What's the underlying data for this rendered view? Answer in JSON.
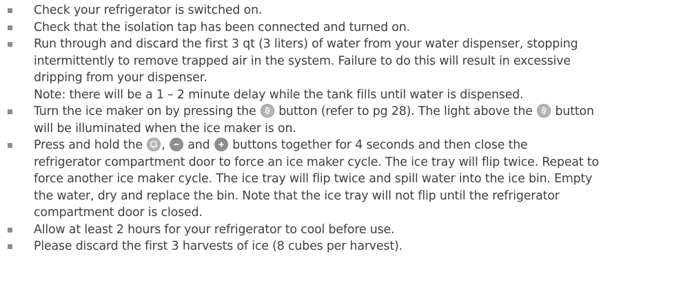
{
  "items": [
    {
      "lines": [
        "Check your refrigerator is switched on."
      ]
    },
    {
      "lines": [
        "Check that the isolation tap has been connected and turned on."
      ]
    },
    {
      "lines": [
        "Run through and discard the first 3 qt (3 liters) of water from your water dispenser, stopping",
        "intermittently to remove trapped air in the system. Failure to do this will result in excessive",
        "dripping from your dispenser.",
        "Note: there will be a 1 – 2 minute delay while the tank fills until water is dispensed."
      ]
    },
    {
      "icemaker": {
        "l1_a": "Turn the ice maker on by pressing the ",
        "l1_b": " button (refer to pg 28). The light above the ",
        "l1_c": " button",
        "l2": "will be illuminated when the ice maker is on."
      }
    },
    {
      "force": {
        "l1_a": "Press and hold the ",
        "l1_b": ", ",
        "l1_c": " and ",
        "l1_d": " buttons together for 4 seconds and then close the",
        "rest": [
          "refrigerator compartment door to force an ice maker cycle. The ice tray will flip twice. Repeat to",
          "force another ice maker cycle. The ice tray will flip twice and spill water into the ice bin.  Empty",
          "the water, dry and replace the bin. Note that the ice tray will not flip until the refrigerator",
          "compartment door is closed."
        ]
      }
    },
    {
      "lines": [
        "Allow at least 2 hours for your refrigerator to cool before use."
      ]
    },
    {
      "lines": [
        "Please discard the first 3 harvests of ice (8 cubes per harvest)."
      ]
    }
  ],
  "icons": {
    "ice_maker": "ice-maker-icon",
    "alarm": "bell-icon",
    "minus": "minus-icon",
    "plus": "plus-icon"
  },
  "colors": {
    "text": "#3f3f3f",
    "bullet": "#8c8c8c",
    "button_light": "#b4b4b4",
    "button_dark": "#8e8e8e"
  }
}
